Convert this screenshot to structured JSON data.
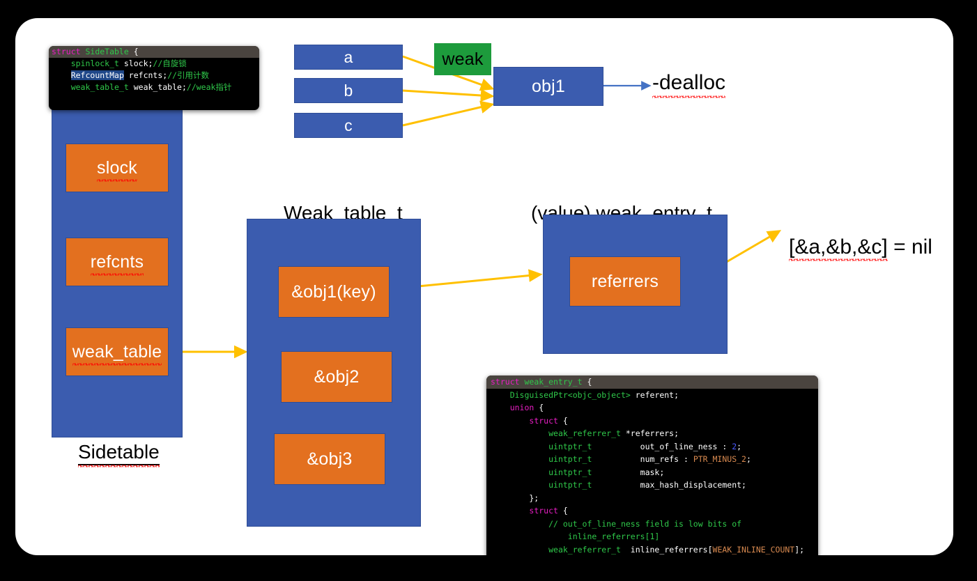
{
  "page": {
    "background": "#000000",
    "card_background": "#ffffff"
  },
  "colors": {
    "blue": "#3B5CAF",
    "orange": "#E3701F",
    "green": "#1D9B3C",
    "arrow_orange": "#FFC000",
    "arrow_blue": "#4472C4",
    "spellcheck_red": "#FF0000"
  },
  "code_sidetable": {
    "lines": [
      {
        "segments": [
          {
            "t": "struct ",
            "c": "kw"
          },
          {
            "t": "SideTable ",
            "c": "typ"
          },
          {
            "t": "{",
            "c": "pl"
          }
        ],
        "header": true
      },
      {
        "segments": [
          {
            "t": "    ",
            "c": "pl"
          },
          {
            "t": "spinlock_t ",
            "c": "typ"
          },
          {
            "t": "slock;",
            "c": "pl"
          },
          {
            "t": "//自旋锁",
            "c": "cmt"
          }
        ]
      },
      {
        "segments": [
          {
            "t": "    ",
            "c": "pl"
          },
          {
            "t": "RefcountMap",
            "c": "sel"
          },
          {
            "t": " refcnts;",
            "c": "pl"
          },
          {
            "t": "//引用计数",
            "c": "cmt"
          }
        ]
      },
      {
        "segments": [
          {
            "t": "    ",
            "c": "pl"
          },
          {
            "t": "weak_table_t ",
            "c": "typ"
          },
          {
            "t": "weak_table;",
            "c": "pl"
          },
          {
            "t": "//weak指针",
            "c": "cmt"
          }
        ]
      }
    ]
  },
  "code_weak_entry": {
    "lines": [
      {
        "segments": [
          {
            "t": "struct ",
            "c": "kw"
          },
          {
            "t": "weak_entry_t ",
            "c": "typ"
          },
          {
            "t": "{",
            "c": "pl"
          }
        ],
        "header": true
      },
      {
        "segments": [
          {
            "t": "    ",
            "c": "pl"
          },
          {
            "t": "DisguisedPtr<objc_object>",
            "c": "typ"
          },
          {
            "t": " referent;",
            "c": "pl"
          }
        ]
      },
      {
        "segments": [
          {
            "t": "    ",
            "c": "pl"
          },
          {
            "t": "union",
            "c": "kw"
          },
          {
            "t": " {",
            "c": "pl"
          }
        ]
      },
      {
        "segments": [
          {
            "t": "        ",
            "c": "pl"
          },
          {
            "t": "struct",
            "c": "kw"
          },
          {
            "t": " {",
            "c": "pl"
          }
        ]
      },
      {
        "segments": [
          {
            "t": "            ",
            "c": "pl"
          },
          {
            "t": "weak_referrer_t ",
            "c": "typ"
          },
          {
            "t": "*referrers;",
            "c": "pl"
          }
        ]
      },
      {
        "segments": [
          {
            "t": "            ",
            "c": "pl"
          },
          {
            "t": "uintptr_t",
            "c": "typ"
          },
          {
            "t": "          out_of_line_ness : ",
            "c": "pl"
          },
          {
            "t": "2",
            "c": "num"
          },
          {
            "t": ";",
            "c": "pl"
          }
        ]
      },
      {
        "segments": [
          {
            "t": "            ",
            "c": "pl"
          },
          {
            "t": "uintptr_t",
            "c": "typ"
          },
          {
            "t": "          num_refs : ",
            "c": "pl"
          },
          {
            "t": "PTR_MINUS_2",
            "c": "cst"
          },
          {
            "t": ";",
            "c": "pl"
          }
        ]
      },
      {
        "segments": [
          {
            "t": "            ",
            "c": "pl"
          },
          {
            "t": "uintptr_t",
            "c": "typ"
          },
          {
            "t": "          mask;",
            "c": "pl"
          }
        ]
      },
      {
        "segments": [
          {
            "t": "            ",
            "c": "pl"
          },
          {
            "t": "uintptr_t",
            "c": "typ"
          },
          {
            "t": "          max_hash_displacement;",
            "c": "pl"
          }
        ]
      },
      {
        "segments": [
          {
            "t": "        };",
            "c": "pl"
          }
        ]
      },
      {
        "segments": [
          {
            "t": "        ",
            "c": "pl"
          },
          {
            "t": "struct",
            "c": "kw"
          },
          {
            "t": " {",
            "c": "pl"
          }
        ]
      },
      {
        "segments": [
          {
            "t": "            ",
            "c": "pl"
          },
          {
            "t": "// out_of_line_ness field is low bits of",
            "c": "cmt"
          }
        ]
      },
      {
        "segments": [
          {
            "t": "                ",
            "c": "pl"
          },
          {
            "t": "inline_referrers[1]",
            "c": "cmt"
          }
        ]
      },
      {
        "segments": [
          {
            "t": "            ",
            "c": "pl"
          },
          {
            "t": "weak_referrer_t",
            "c": "typ"
          },
          {
            "t": "  inline_referrers[",
            "c": "pl"
          },
          {
            "t": "WEAK_INLINE_COUNT",
            "c": "cst"
          },
          {
            "t": "];",
            "c": "pl"
          }
        ]
      },
      {
        "segments": [
          {
            "t": "        };",
            "c": "pl"
          }
        ]
      },
      {
        "segments": [
          {
            "t": "    };",
            "c": "pl"
          }
        ]
      }
    ]
  },
  "sidetable": {
    "caption": "Sidetable",
    "slots": [
      {
        "label": "slock"
      },
      {
        "label": "refcnts"
      },
      {
        "label": "weak_table"
      }
    ]
  },
  "top_diagram": {
    "refs": [
      "a",
      "b",
      "c"
    ],
    "weak_badge": "weak",
    "object": "obj1",
    "dealloc": "-dealloc"
  },
  "weak_table": {
    "title": "Weak_table_t",
    "entries": [
      {
        "label": "&obj1(key)"
      },
      {
        "label": "&obj2"
      },
      {
        "label": "&obj3"
      }
    ]
  },
  "weak_entry": {
    "title_prefix": "(value) ",
    "title_main": "weak_entry_t",
    "slot": "referrers",
    "annotation_main": "[&a,&b,&c]",
    "annotation_tail": " = nil"
  }
}
